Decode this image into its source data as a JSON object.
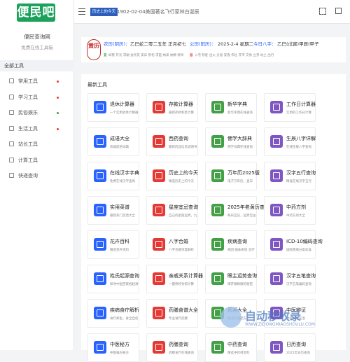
{
  "sidebar": {
    "logo_text": "便民吧",
    "site_name": "便民查询网",
    "site_sub": "免费在线工具箱",
    "all_tools": "全部工具",
    "items": [
      {
        "label": "常用工具",
        "dot": "#e53935"
      },
      {
        "label": "学习工具",
        "dot": "#e53935"
      },
      {
        "label": "民俗娱乐",
        "dot": "#43a047"
      },
      {
        "label": "生活工具",
        "dot": "#e53935"
      },
      {
        "label": "站长工具",
        "dot": ""
      },
      {
        "label": "计算工具",
        "dot": ""
      },
      {
        "label": "快递查询",
        "dot": ""
      }
    ]
  },
  "topbar": {
    "tag": "历史上的今天",
    "marquee": "1902-02-04美国著名飞行家林白诞辰"
  },
  "calendar": {
    "huangli": "黄历",
    "nongli_label": "农历(阴历)：",
    "nongli_value": "乙巳蛇二零二五年 正月初七",
    "gongli_label": "公历(阳历)：",
    "gongli_value": "2025-2-4 星期二",
    "today_label": "今日八字：",
    "today_value": "乙巳(戊寅)甲辰(甲子",
    "yi_label": "宜",
    "yi_text": "嫁娶 开光 求嗣 会亲友 安床 祭祀 求医 纳采 纳婿 修饰",
    "ji_label": "忌",
    "ji_text": "入宅 移徙 出火 分居 安香 作灶 开市 交易 立券 动土 出行"
  },
  "section_title": "最新工具",
  "cards": [
    {
      "name": "退休计算器",
      "desc": "一个实用退休计算器",
      "color": "#2962ff"
    },
    {
      "name": "存款计算器",
      "desc": "最新存款利息计算",
      "color": "#e53935"
    },
    {
      "name": "新华字典",
      "desc": "新华字典在线查询",
      "color": "#43a047"
    },
    {
      "name": "工作日计算器",
      "desc": "实用的工作日计算",
      "color": "#7e57c2"
    },
    {
      "name": "成语大全",
      "desc": "权威成语词典",
      "color": "#2962ff"
    },
    {
      "name": "西药查询",
      "desc": "最新药品信息说明书",
      "color": "#e53935"
    },
    {
      "name": "佛学大辞典",
      "desc": "佛学词典在线查询",
      "color": "#43a047"
    },
    {
      "name": "生辰八字详解",
      "desc": "在线生辰八字查询",
      "color": "#7e57c2"
    },
    {
      "name": "在线汉字字典",
      "desc": "免费在线汉字查询",
      "color": "#2962ff"
    },
    {
      "name": "历史上的今天",
      "desc": "精选历史上的今天",
      "color": "#e53935"
    },
    {
      "name": "万年历2025版",
      "desc": "电子万年历，查日",
      "color": "#43a047"
    },
    {
      "name": "汉字五行查询",
      "desc": "精准在线汉字五行",
      "color": "#7e57c2"
    },
    {
      "name": "实用菜谱",
      "desc": "最新热门菜谱大全",
      "color": "#2962ff"
    },
    {
      "name": "星座宜忌查询",
      "desc": "自己的星座运势，九",
      "color": "#e53935"
    },
    {
      "name": "2025年老黄历查询",
      "desc": "每日宜忌，运势吉凶",
      "color": "#43a047"
    },
    {
      "name": "中药方剂",
      "desc": "中药方剂大全",
      "color": "#7e57c2"
    },
    {
      "name": "花卉百科",
      "desc": "精选花卉资料",
      "color": "#2962ff"
    },
    {
      "name": "八字合婚",
      "desc": "八字合婚深度解析",
      "color": "#e53935"
    },
    {
      "name": "疾病查询",
      "desc": "病因 临床表现 治疗",
      "color": "#43a047"
    },
    {
      "name": "ICD-10编码查询",
      "desc": "国际疾病分类标准",
      "color": "#7e57c2"
    },
    {
      "name": "姓氏起源查询",
      "desc": "探寻中国百家姓起源",
      "color": "#2962ff"
    },
    {
      "name": "亲戚关系计算器",
      "desc": "一键称呼对照计算",
      "color": "#e53935"
    },
    {
      "name": "眼主运势查询",
      "desc": "揭开眼睛跳的秘密",
      "color": "#43a047"
    },
    {
      "name": "汉字五笔查询",
      "desc": "汉字五笔编码查询",
      "color": "#7e57c2"
    },
    {
      "name": "疾病食疗解析",
      "desc": "食疗养生，食全自愈",
      "color": "#2962ff"
    },
    {
      "name": "药膳食谱大全",
      "desc": "专业食疗药膳",
      "color": "#e53935"
    },
    {
      "name": "药酒大全",
      "desc": "精选药酒配方",
      "color": "#43a047"
    },
    {
      "name": "中医辨证",
      "desc": "中医辨证论治",
      "color": "#7e57c2"
    },
    {
      "name": "中医秘方",
      "desc": "中医偏方秘方",
      "color": "#2962ff"
    },
    {
      "name": "药膳查询",
      "desc": "药膳食疗在线查询",
      "color": "#e53935"
    },
    {
      "name": "中药查询",
      "desc": "精选中药材资料",
      "color": "#43a047"
    },
    {
      "name": "日历查询",
      "desc": "2025年日历查询",
      "color": "#7e57c2"
    }
  ],
  "watermark": {
    "text": "自动秒收录",
    "sub": "WWW.ZIDONGMIAOSHOULU.COM"
  }
}
